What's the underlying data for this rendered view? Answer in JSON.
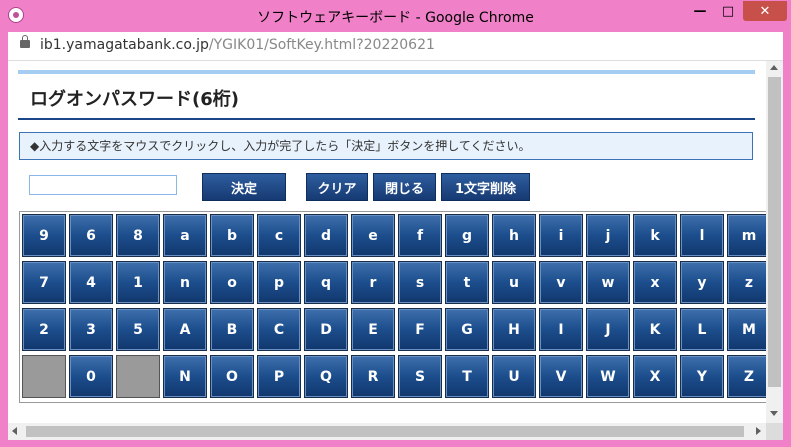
{
  "window": {
    "title": "ソフトウェアキーボード - Google Chrome",
    "minimize": "—",
    "maximize": "□",
    "close": "✕"
  },
  "address": {
    "domain": "ib1.yamagatabank.co.jp",
    "path": "/YGIK01/SoftKey.html?20220621"
  },
  "page": {
    "title": "ログオンパスワード(6桁)",
    "instruction": "◆入力する文字をマウスでクリックし、入力が完了したら「決定」ボタンを押してください。",
    "password_value": ""
  },
  "buttons": {
    "kettei": "決定",
    "clear": "クリア",
    "close": "閉じる",
    "delete_char": "1文字削除"
  },
  "keyboard": {
    "rows": [
      [
        "9",
        "6",
        "8",
        "a",
        "b",
        "c",
        "d",
        "e",
        "f",
        "g",
        "h",
        "i",
        "j",
        "k",
        "l",
        "m"
      ],
      [
        "7",
        "4",
        "1",
        "n",
        "o",
        "p",
        "q",
        "r",
        "s",
        "t",
        "u",
        "v",
        "w",
        "x",
        "y",
        "z"
      ],
      [
        "2",
        "3",
        "5",
        "A",
        "B",
        "C",
        "D",
        "E",
        "F",
        "G",
        "H",
        "I",
        "J",
        "K",
        "L",
        "M"
      ],
      [
        "",
        "0",
        "",
        "N",
        "O",
        "P",
        "Q",
        "R",
        "S",
        "T",
        "U",
        "V",
        "W",
        "X",
        "Y",
        "Z"
      ]
    ]
  }
}
